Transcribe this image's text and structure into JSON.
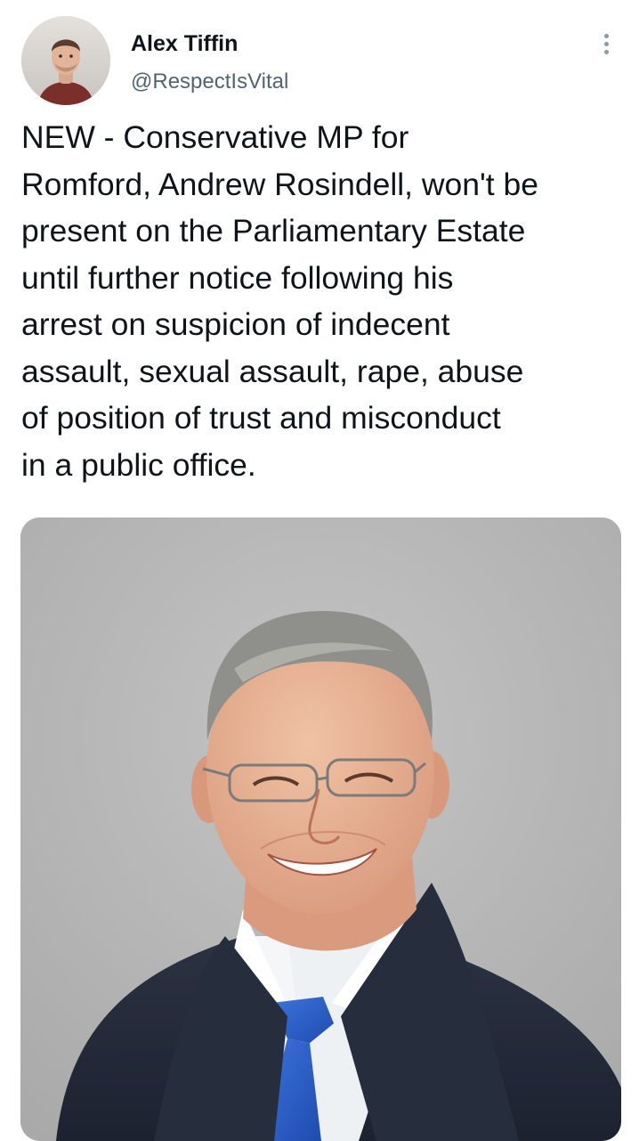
{
  "author": {
    "name": "Alex Tiffin",
    "handle": "@RespectIsVital"
  },
  "tweet": {
    "text_lines": [
      "NEW - Conservative MP for",
      "Romford, Andrew Rosindell, won't be",
      "present on the Parliamentary Estate",
      "until further notice following his",
      "arrest on suspicion of indecent",
      "assault, sexual assault, rape, abuse",
      "of position of trust and misconduct",
      "in a public office."
    ]
  },
  "icons": {
    "more": "more-vertical-icon"
  },
  "colors": {
    "text": "#0f1419",
    "secondary": "#536471",
    "tie": "#2a5fc9",
    "suit": "#232a38"
  }
}
